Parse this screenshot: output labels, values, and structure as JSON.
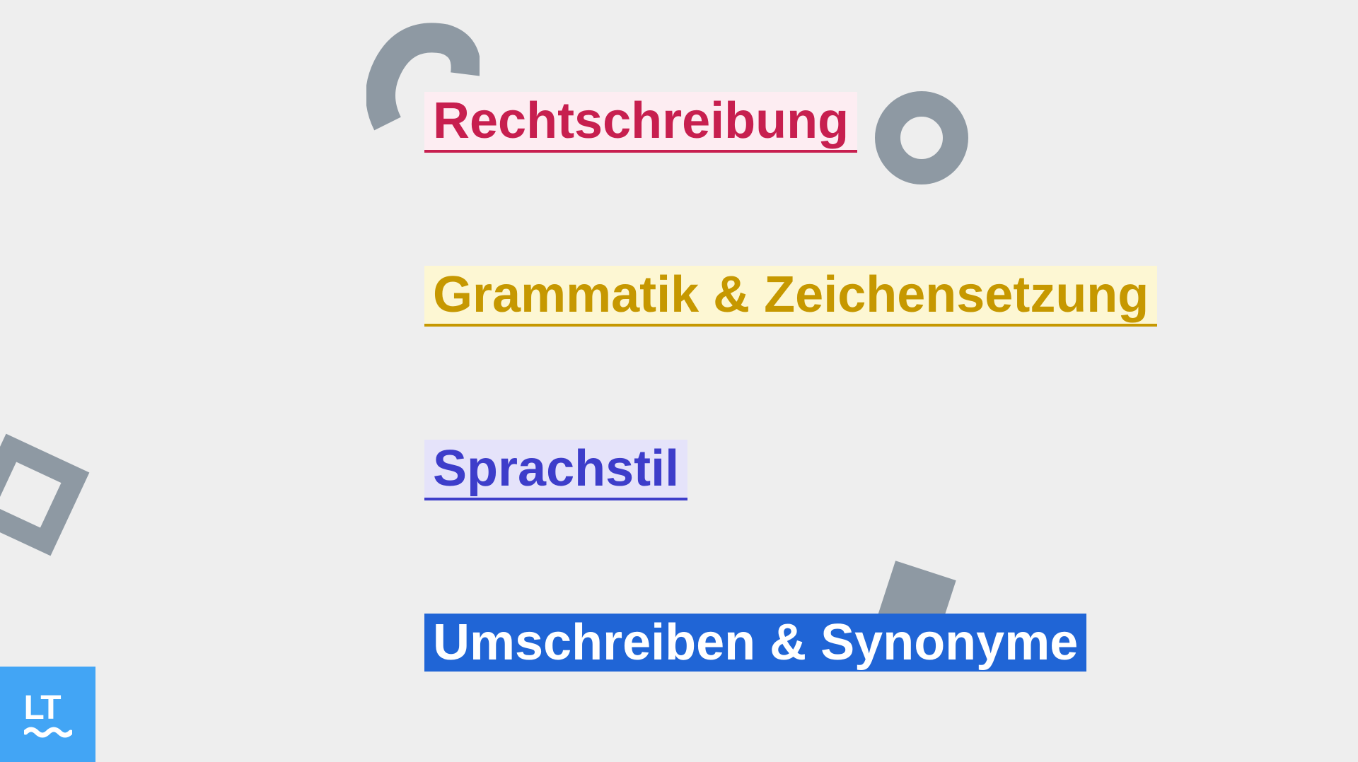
{
  "categories": {
    "spelling": "Rechtschreibung",
    "grammar": "Grammatik & Zeichensetzung",
    "style": "Sprachstil",
    "rewrite": "Umschreiben & Synonyme"
  },
  "logo": {
    "text": "LT"
  },
  "colors": {
    "background": "#eeeeee",
    "spelling": "#c71f4f",
    "grammar": "#c69800",
    "style": "#3d3dca",
    "rewrite": "#2065d6",
    "logo_bg": "#42a5f5",
    "shape_gray": "#8e99a3"
  }
}
